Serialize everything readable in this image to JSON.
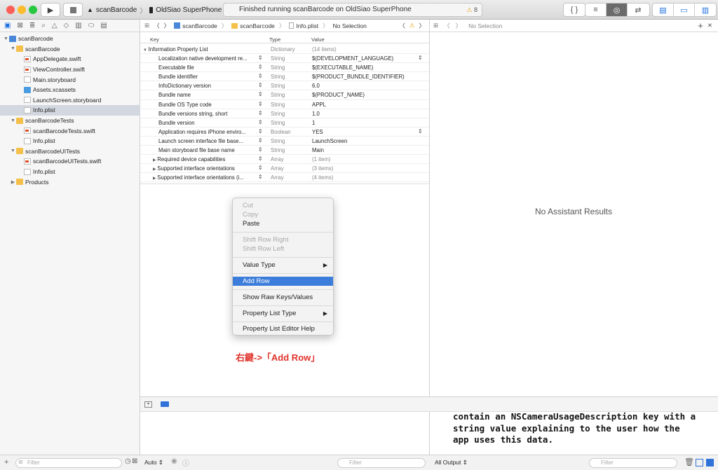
{
  "toolbar": {
    "scheme_name": "scanBarcode",
    "device_name": "OldSiao SuperPhone",
    "activity_text": "Finished running scanBarcode on OldSiao SuperPhone",
    "warning_count": "8"
  },
  "navigator": {
    "items": [
      {
        "label": "scanBarcode",
        "icon": "project-icon"
      },
      {
        "label": "scanBarcode",
        "icon": "folder-icon"
      },
      {
        "label": "AppDelegate.swift",
        "icon": "swift-file-icon"
      },
      {
        "label": "ViewController.swift",
        "icon": "swift-file-icon"
      },
      {
        "label": "Main.storyboard",
        "icon": "storyboard-icon"
      },
      {
        "label": "Assets.xcassets",
        "icon": "assets-icon"
      },
      {
        "label": "LaunchScreen.storyboard",
        "icon": "storyboard-icon"
      },
      {
        "label": "Info.plist",
        "icon": "plist-icon"
      },
      {
        "label": "scanBarcodeTests",
        "icon": "folder-icon"
      },
      {
        "label": "scanBarcodeTests.swift",
        "icon": "swift-file-icon"
      },
      {
        "label": "Info.plist",
        "icon": "plist-icon"
      },
      {
        "label": "scanBarcodeUITests",
        "icon": "folder-icon"
      },
      {
        "label": "scanBarcodeUITests.swift",
        "icon": "swift-file-icon"
      },
      {
        "label": "Info.plist",
        "icon": "plist-icon"
      },
      {
        "label": "Products",
        "icon": "folder-icon"
      }
    ],
    "selected_index": 7,
    "filter_placeholder": "Filter"
  },
  "editor": {
    "breadcrumb": [
      "scanBarcode",
      "scanBarcode",
      "Info.plist",
      "No Selection"
    ],
    "columns": {
      "key": "Key",
      "type": "Type",
      "value": "Value"
    },
    "rows": [
      {
        "key": "Information Property List",
        "type": "Dictionary",
        "value": "(14 items)"
      },
      {
        "key": "Localization native development re...",
        "type": "String",
        "value": "$(DEVELOPMENT_LANGUAGE)"
      },
      {
        "key": "Executable file",
        "type": "String",
        "value": "$(EXECUTABLE_NAME)"
      },
      {
        "key": "Bundle identifier",
        "type": "String",
        "value": "$(PRODUCT_BUNDLE_IDENTIFIER)"
      },
      {
        "key": "InfoDictionary version",
        "type": "String",
        "value": "6.0"
      },
      {
        "key": "Bundle name",
        "type": "String",
        "value": "$(PRODUCT_NAME)"
      },
      {
        "key": "Bundle OS Type code",
        "type": "String",
        "value": "APPL"
      },
      {
        "key": "Bundle versions string, short",
        "type": "String",
        "value": "1.0"
      },
      {
        "key": "Bundle version",
        "type": "String",
        "value": "1"
      },
      {
        "key": "Application requires iPhone enviro...",
        "type": "Boolean",
        "value": "YES"
      },
      {
        "key": "Launch screen interface file base...",
        "type": "String",
        "value": "LaunchScreen"
      },
      {
        "key": "Main storyboard file base name",
        "type": "String",
        "value": "Main"
      },
      {
        "key": "Required device capabilities",
        "type": "Array",
        "value": "(1 item)"
      },
      {
        "key": "Supported interface orientations",
        "type": "Array",
        "value": "(3 items)"
      },
      {
        "key": "Supported interface orientations (i...",
        "type": "Array",
        "value": "(4 items)"
      }
    ]
  },
  "context_menu": {
    "cut": "Cut",
    "copy": "Copy",
    "paste": "Paste",
    "shift_right": "Shift Row Right",
    "shift_left": "Shift Row Left",
    "value_type": "Value Type",
    "add_row": "Add Row",
    "show_raw": "Show Raw Keys/Values",
    "plist_type": "Property List Type",
    "help": "Property List Editor Help"
  },
  "annotation": "右鍵->「Add Row」",
  "assistant": {
    "selection": "No Selection",
    "empty_text": "No Assistant Results"
  },
  "console": {
    "text": "contain an NSCameraUsageDescription key with a\nstring value explaining to the user how the\napp uses this data."
  },
  "bottom": {
    "auto_label": "Auto",
    "filter_placeholder": "Filter",
    "output_label": "All Output",
    "filter2_placeholder": "Filter"
  },
  "colors": {
    "accent": "#3c7ddb",
    "annotation": "#e0332b"
  }
}
